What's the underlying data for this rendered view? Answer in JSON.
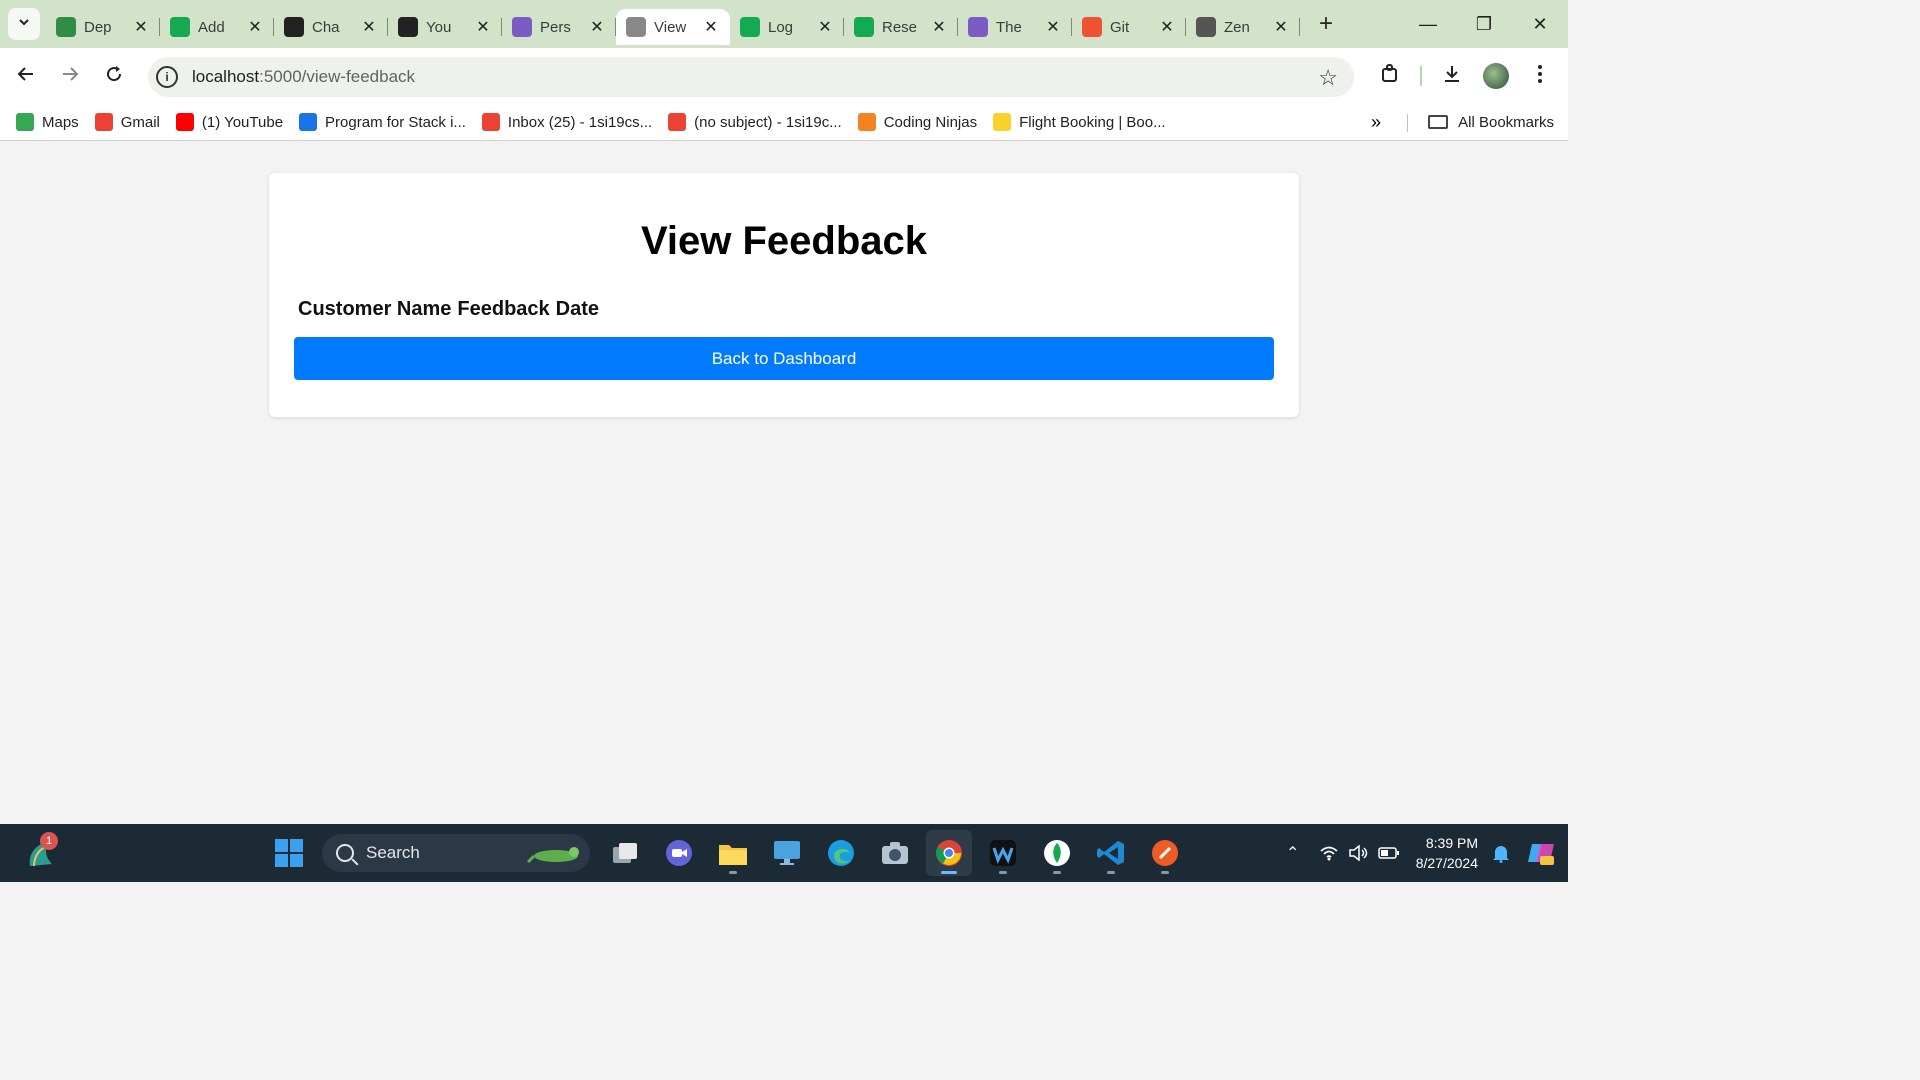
{
  "browser": {
    "tabs": [
      {
        "title": "Dep",
        "icon": "geeksforgeeks-icon",
        "color": "#2f8d46"
      },
      {
        "title": "Add",
        "icon": "mongodb-leaf-icon",
        "color": "#13aa52"
      },
      {
        "title": "Cha",
        "icon": "openai-icon",
        "color": "#222222"
      },
      {
        "title": "You",
        "icon": "github-icon",
        "color": "#222222"
      },
      {
        "title": "Pers",
        "icon": "heroku-icon",
        "color": "#7b5cc4"
      },
      {
        "title": "View",
        "icon": "globe-icon",
        "color": "#888888",
        "active": true
      },
      {
        "title": "Log",
        "icon": "mongodb-leaf-icon",
        "color": "#13aa52"
      },
      {
        "title": "Rese",
        "icon": "mongodb-leaf-icon",
        "color": "#13aa52"
      },
      {
        "title": "The",
        "icon": "heroku-icon",
        "color": "#7b5cc4"
      },
      {
        "title": "Git",
        "icon": "git-icon",
        "color": "#f05033"
      },
      {
        "title": "Zen",
        "icon": "zen-class-icon",
        "color": "#555555"
      }
    ],
    "url_host": "localhost",
    "url_path": ":5000/view-feedback",
    "bookmarks": [
      {
        "label": "Maps",
        "icon": "maps-icon"
      },
      {
        "label": "Gmail",
        "icon": "gmail-icon"
      },
      {
        "label": "(1) YouTube",
        "icon": "youtube-icon"
      },
      {
        "label": "Program for Stack i...",
        "icon": "program-icon"
      },
      {
        "label": "Inbox (25) - 1si19cs...",
        "icon": "gmail-icon"
      },
      {
        "label": "(no subject) - 1si19c...",
        "icon": "gmail-icon"
      },
      {
        "label": "Coding Ninjas",
        "icon": "coding-ninjas-icon"
      },
      {
        "label": "Flight Booking | Boo...",
        "icon": "flipkart-icon"
      }
    ],
    "all_bookmarks": "All Bookmarks"
  },
  "page": {
    "heading": "View Feedback",
    "columns": [
      "Customer Name",
      "Feedback",
      "Date"
    ],
    "back_button": "Back to Dashboard",
    "accent": "#007bff"
  },
  "taskbar": {
    "widget_badge": "1",
    "search_label": "Search",
    "time": "8:39 PM",
    "date": "8/27/2024"
  }
}
